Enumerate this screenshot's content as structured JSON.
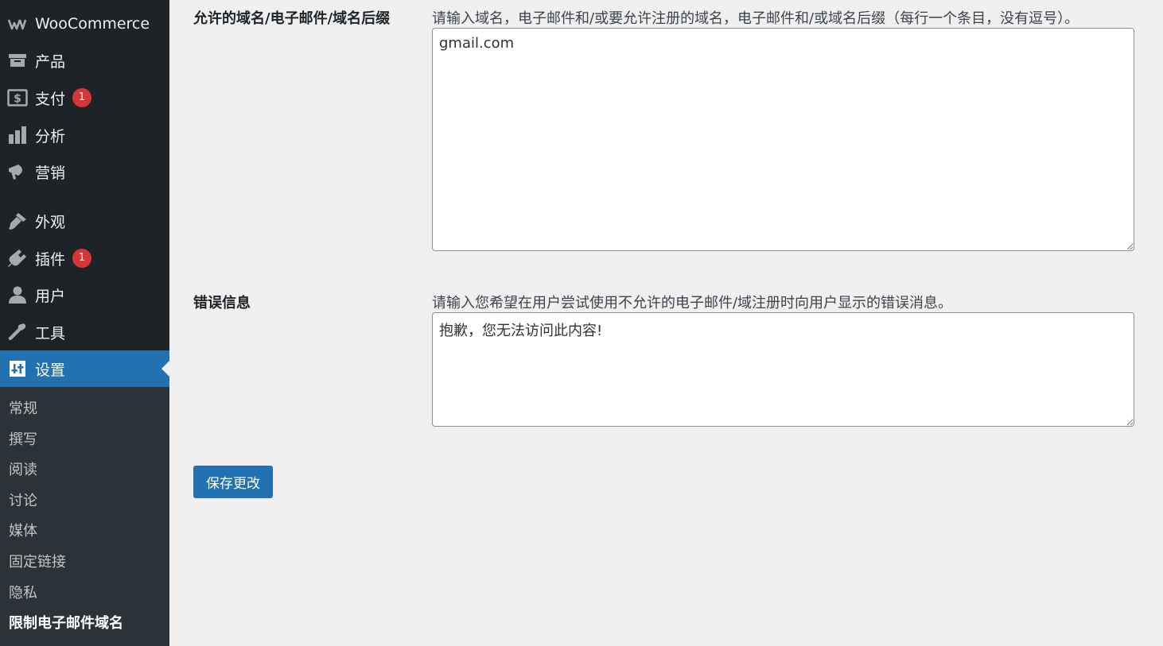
{
  "sidebar": {
    "items": [
      {
        "label": "WooCommerce",
        "icon": "woo-icon"
      },
      {
        "label": "产品",
        "icon": "archive-icon"
      },
      {
        "label": "支付",
        "icon": "dollar-icon",
        "badge": "1"
      },
      {
        "label": "分析",
        "icon": "bar-chart-icon"
      },
      {
        "label": "营销",
        "icon": "megaphone-icon"
      },
      {
        "label": "外观",
        "icon": "paintbrush-icon"
      },
      {
        "label": "插件",
        "icon": "plug-icon",
        "badge": "1"
      },
      {
        "label": "用户",
        "icon": "user-icon"
      },
      {
        "label": "工具",
        "icon": "wrench-icon"
      },
      {
        "label": "设置",
        "icon": "settings-icon",
        "active": true
      }
    ],
    "submenu": [
      "常规",
      "撰写",
      "阅读",
      "讨论",
      "媒体",
      "固定链接",
      "隐私",
      "限制电子邮件域名"
    ]
  },
  "form": {
    "allowed": {
      "label": "允许的域名/电子邮件/域名后缀",
      "description": "请输入域名，电子邮件和/或要允许注册的域名，电子邮件和/或域名后缀（每行一个条目，没有逗号）。",
      "value": "gmail.com"
    },
    "error": {
      "label": "错误信息",
      "description": "请输入您希望在用户尝试使用不允许的电子邮件/域注册时向用户显示的错误消息。",
      "value": "抱歉，您无法访问此内容!"
    },
    "save_label": "保存更改"
  },
  "colors": {
    "sidebar_bg": "#1d2327",
    "submenu_bg": "#2c3338",
    "accent": "#2271b1",
    "badge": "#d63638",
    "page_bg": "#f0f0f1"
  }
}
